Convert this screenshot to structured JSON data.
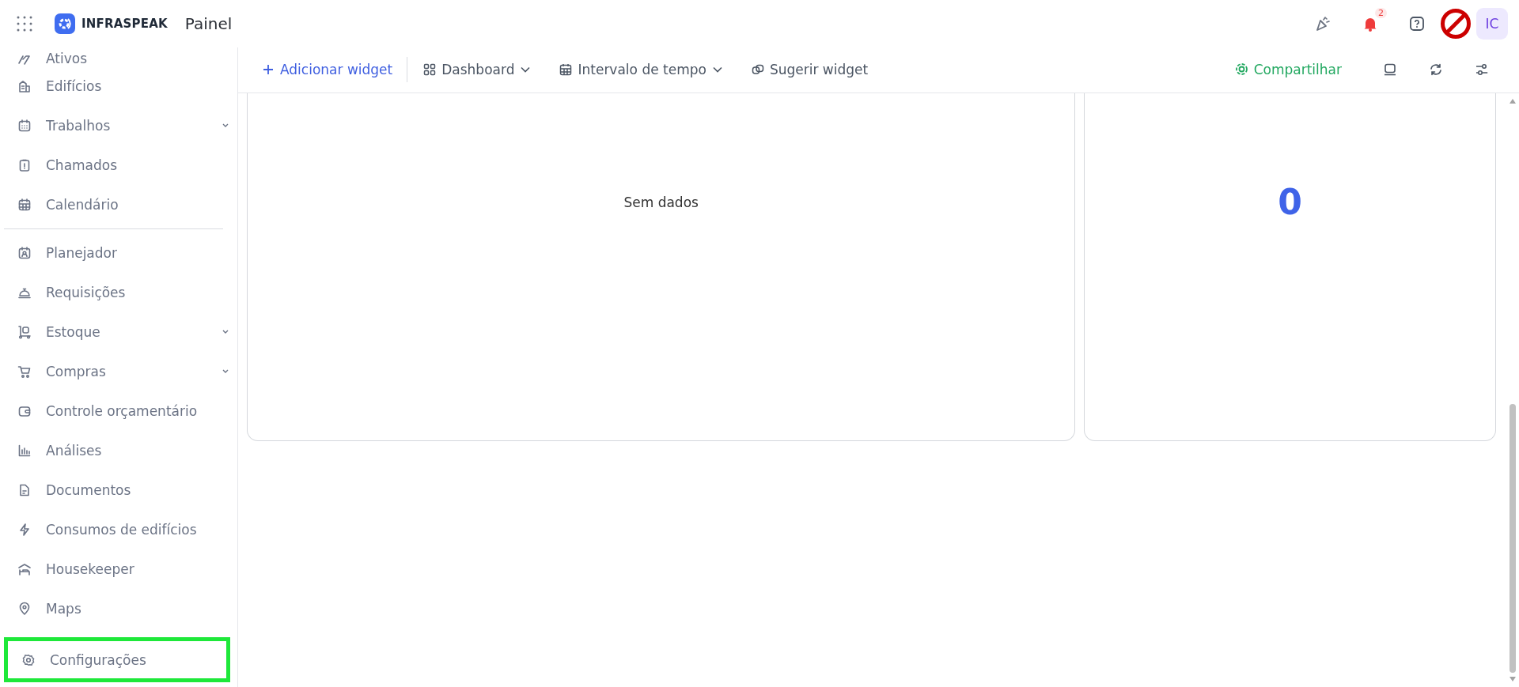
{
  "header": {
    "brand": "INFRASPEAK",
    "page_title": "Painel",
    "notifications_badge": "2",
    "avatar": "IC"
  },
  "sidebar": {
    "groups": [
      [
        {
          "label": "Ativos",
          "expandable": false
        },
        {
          "label": "Edifícios",
          "expandable": false
        },
        {
          "label": "Trabalhos",
          "expandable": true
        },
        {
          "label": "Chamados",
          "expandable": false
        },
        {
          "label": "Calendário",
          "expandable": false
        }
      ],
      [
        {
          "label": "Planejador",
          "expandable": false
        },
        {
          "label": "Requisições",
          "expandable": false
        },
        {
          "label": "Estoque",
          "expandable": true
        },
        {
          "label": "Compras",
          "expandable": true
        },
        {
          "label": "Controle orçamentário",
          "expandable": false
        },
        {
          "label": "Análises",
          "expandable": false
        },
        {
          "label": "Documentos",
          "expandable": false
        },
        {
          "label": "Consumos de edifícios",
          "expandable": false
        },
        {
          "label": "Housekeeper",
          "expandable": false
        },
        {
          "label": "Maps",
          "expandable": false
        }
      ]
    ],
    "footer_item": {
      "label": "Configurações",
      "highlighted": true
    }
  },
  "toolbar": {
    "add_widget": "Adicionar widget",
    "dashboard": "Dashboard",
    "time_range": "Intervalo de tempo",
    "suggest_widget": "Sugerir widget",
    "share": "Compartilhar"
  },
  "widgets": [
    {
      "kind": "empty",
      "text": "Sem dados"
    },
    {
      "kind": "number",
      "text": "0"
    }
  ]
}
